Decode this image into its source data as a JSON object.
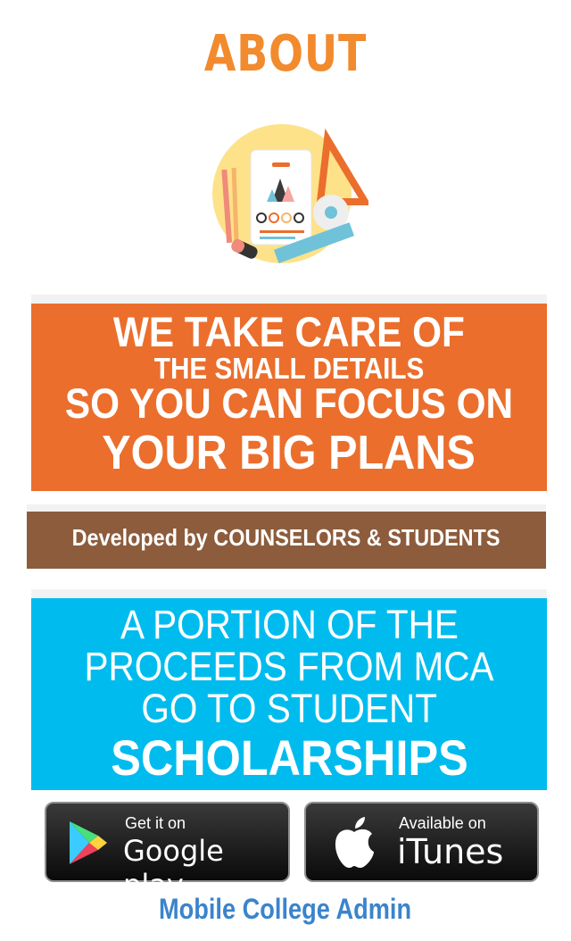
{
  "header": {
    "title": "ABOUT"
  },
  "banner_orange": {
    "line1": "WE TAKE CARE OF",
    "line2": "THE SMALL DETAILS",
    "line3": "SO YOU CAN FOCUS ON",
    "line4": "YOUR BIG PLANS",
    "color": "#eb6e2c"
  },
  "banner_brown": {
    "text": "Developed by COUNSELORS & STUDENTS",
    "color": "#8c5c3c"
  },
  "banner_blue": {
    "line1": "A PORTION OF THE",
    "line2": "PROCEEDS FROM MCA",
    "line3": "GO TO STUDENT",
    "line4": "SCHOLARSHIPS",
    "color": "#00bcee"
  },
  "stores": {
    "google": {
      "small": "Get it on",
      "big": "Google play",
      "icon": "google-play-icon"
    },
    "itunes": {
      "small": "Available on",
      "big": "iTunes",
      "icon": "apple-icon"
    }
  },
  "footer": {
    "text": "Mobile College Admin",
    "color": "#3a84cb"
  }
}
